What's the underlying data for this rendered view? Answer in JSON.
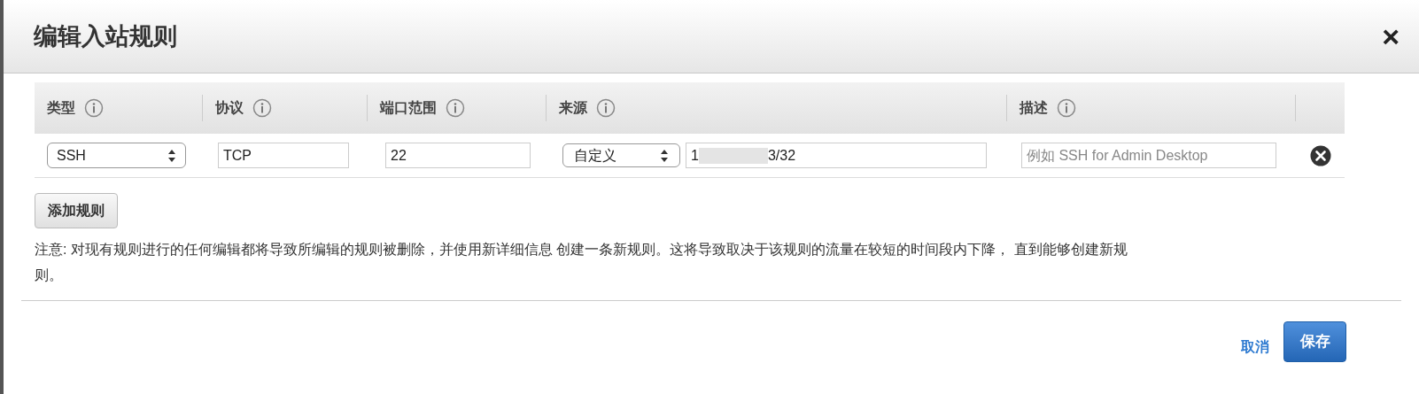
{
  "dialog": {
    "title": "编辑入站规则",
    "close": "×"
  },
  "table": {
    "columns": [
      {
        "label": "类型"
      },
      {
        "label": "协议"
      },
      {
        "label": "端口范围"
      },
      {
        "label": "来源"
      },
      {
        "label": "描述"
      }
    ],
    "rows": [
      {
        "type": "SSH",
        "protocol": "TCP",
        "port_range": "22",
        "source_kind": "自定义",
        "source_value_start": "1",
        "source_value_end": "3/32",
        "description_placeholder": "例如 SSH for Admin Desktop"
      }
    ]
  },
  "add_button": "添加规则",
  "note": "注意: 对现有规则进行的任何编辑都将导致所编辑的规则被删除，并使用新详细信息 创建一条新规则。这将导致取决于该规则的流量在较短的时间段内下降， 直到能够创建新规则。",
  "buttons": {
    "cancel": "取消",
    "save": "保存"
  }
}
